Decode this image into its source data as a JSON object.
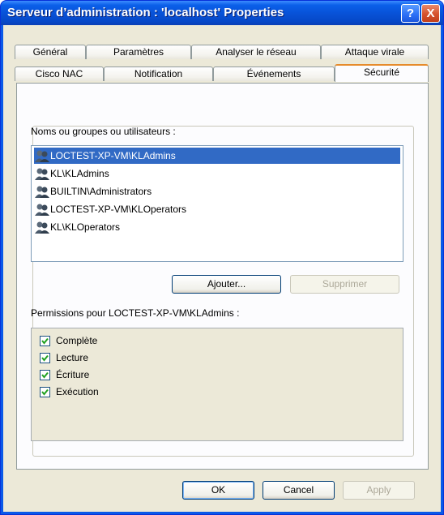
{
  "window": {
    "title": "Serveur d’administration : 'localhost' Properties",
    "help_label": "?",
    "close_label": "X"
  },
  "tabs_back": [
    "Général",
    "Paramètres",
    "Analyser le réseau",
    "Attaque virale"
  ],
  "tabs_front": [
    "Cisco NAC",
    "Notification",
    "Événements",
    "Sécurité"
  ],
  "active_tab": "Sécurité",
  "security": {
    "users_label": "Noms ou groupes ou utilisateurs :",
    "users": [
      "LOCTEST-XP-VM\\KLAdmins",
      "KL\\KLAdmins",
      "BUILTIN\\Administrators",
      "LOCTEST-XP-VM\\KLOperators",
      "KL\\KLOperators"
    ],
    "selected_user": "LOCTEST-XP-VM\\KLAdmins",
    "add_button": "Ajouter...",
    "remove_button": "Supprimer",
    "permissions_label": "Permissions pour LOCTEST-XP-VM\\KLAdmins :",
    "permissions": [
      {
        "label": "Complète",
        "checked": true
      },
      {
        "label": "Lecture",
        "checked": true
      },
      {
        "label": "Écriture",
        "checked": true
      },
      {
        "label": "Exécution",
        "checked": true
      }
    ]
  },
  "footer": {
    "ok": "OK",
    "cancel": "Cancel",
    "apply": "Apply"
  }
}
